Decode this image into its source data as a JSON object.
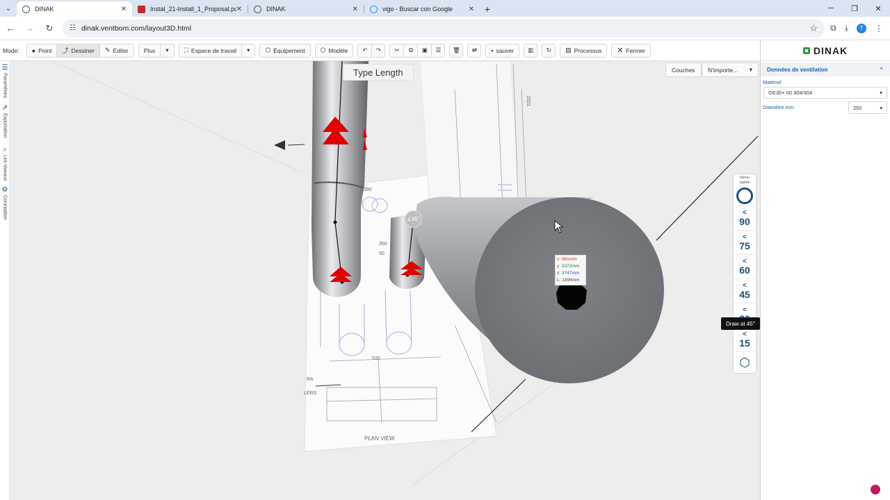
{
  "browser": {
    "tabs": [
      {
        "label": "DINAK",
        "active": true,
        "icon": "globe-icon"
      },
      {
        "label": "Instal_21-Install_1_Proposal.pdf",
        "active": false,
        "icon": "pdf-icon"
      },
      {
        "label": "DINAK",
        "active": false,
        "icon": "globe-icon"
      },
      {
        "label": "vigo - Buscar con Google",
        "active": false,
        "icon": "google-icon"
      }
    ],
    "url": "dinak.ventbom.com/layout3D.html",
    "profile_initial": "T"
  },
  "toolbar": {
    "mode_label": "Mode:",
    "point": "Point",
    "draw": "Dessiner",
    "edit": "Éditer",
    "more": "Plus",
    "workspace": "Espace de travail",
    "equipment": "Équipement",
    "model": "Modèle",
    "save": "sauver",
    "process": "Processus",
    "close": "Fermer"
  },
  "leftstrip": {
    "params": "Paramètres",
    "export": "Exportation",
    "layers": "Les niveaux",
    "design": "Conception"
  },
  "viewport": {
    "type_length": "Type Length",
    "layers_btn": "Couches",
    "filter_btn": "N'importe...",
    "angle_marker": "∠45°",
    "coords": {
      "x": "x: 991mm",
      "y": "y: 3372mm",
      "z": "z: 3747mm",
      "l": "L: 1994mm"
    },
    "drawing_labels": {
      "plan_view": "PLAN VIEW",
      "dim_530": "530",
      "dim_350": "350",
      "dim_1021": "1021",
      "dim_390": "390",
      "dim_50": "50",
      "txt_ra": "RA",
      "txt_lers": "LERS"
    },
    "accent_color": "#1e4e79"
  },
  "quick_menu": {
    "title": "Menu rapide",
    "angles": [
      "90",
      "75",
      "60",
      "45",
      "30",
      "15"
    ],
    "tooltip": "Draw at 45°"
  },
  "panel": {
    "brand": "DINAK",
    "section": "Données de ventilation",
    "material_label": "Matériel",
    "material_value": "GE30+ 00 304/304",
    "diameter_label": "Diamètre  mm",
    "diameter_value": "250"
  }
}
